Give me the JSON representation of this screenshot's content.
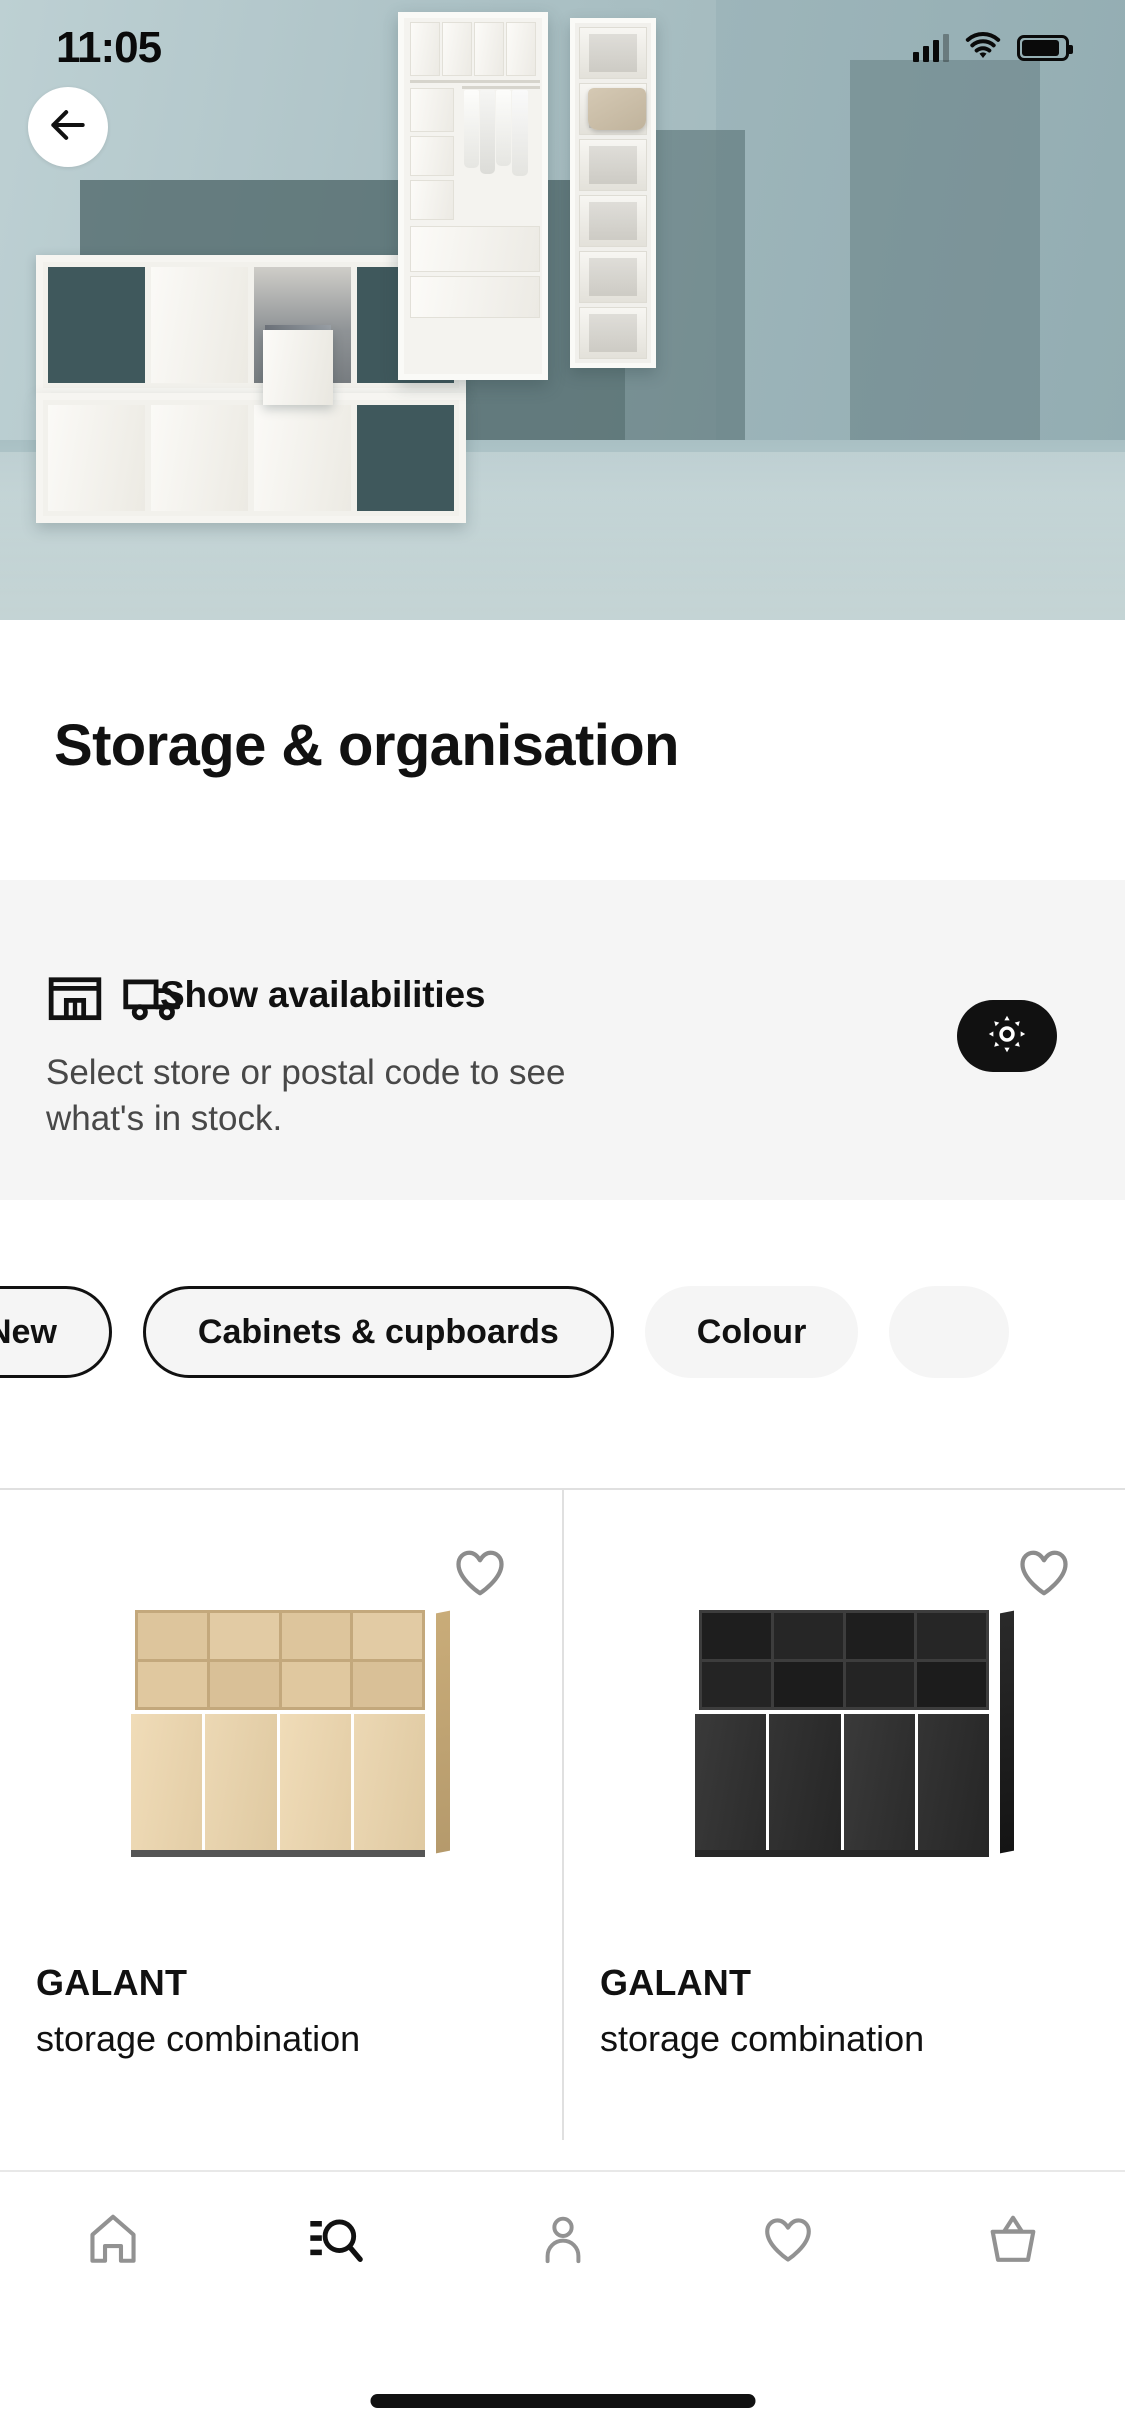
{
  "status_bar": {
    "time": "11:05",
    "signal_icon": "cellular-signal-icon",
    "wifi_icon": "wifi-icon",
    "battery_icon": "battery-icon"
  },
  "hero": {
    "back_button_icon": "arrow-left-icon",
    "alt": "White storage shelving, wardrobe and cabinets against a blue-grey wall"
  },
  "header": {
    "title": "Storage & organisation"
  },
  "availability": {
    "store_icon": "store-icon",
    "delivery_icon": "delivery-truck-icon",
    "heading": "Show availabilities",
    "subtitle": "Select store or postal code to see what's in stock.",
    "settings_button_icon": "gear-icon"
  },
  "filters": {
    "chips": [
      {
        "label": "New",
        "selected": false,
        "truncated": true
      },
      {
        "label": "Cabinets & cupboards",
        "selected": true,
        "truncated": false
      },
      {
        "label": "Colour",
        "selected": false,
        "truncated": false
      },
      {
        "label": "",
        "selected": false,
        "truncated": true
      }
    ]
  },
  "products": [
    {
      "name": "GALANT",
      "description": "storage combination",
      "favourite_icon": "heart-outline-icon",
      "image_alt": "GALANT storage combination with sliding doors, white stained oak veneer",
      "colors": {
        "body": "#e8d3ae",
        "shelf_interior": "#d9c096",
        "door": "#ecd9b7",
        "edge": "#c3a879",
        "shadow": "#2b2b2b"
      }
    },
    {
      "name": "GALANT",
      "description": "storage combination",
      "favourite_icon": "heart-outline-icon",
      "image_alt": "GALANT storage combination with sliding doors, black stained ash veneer",
      "colors": {
        "body": "#3a3a3a",
        "shelf_interior": "#232323",
        "door": "#2e2e2e",
        "edge": "#151515",
        "shadow": "#1a1a1a"
      }
    }
  ],
  "bottom_nav": {
    "items": [
      {
        "name": "home",
        "icon": "home-icon",
        "active": false
      },
      {
        "name": "browse",
        "icon": "browse-search-icon",
        "active": true
      },
      {
        "name": "profile",
        "icon": "person-icon",
        "active": false
      },
      {
        "name": "favourites",
        "icon": "heart-outline-icon",
        "active": false
      },
      {
        "name": "cart",
        "icon": "shopping-basket-icon",
        "active": false
      }
    ],
    "active_color": "#111111",
    "inactive_color": "#929292"
  },
  "system": {
    "home_indicator": "home-indicator-bar"
  },
  "theme": {
    "background": "#ffffff",
    "banner_background": "#f5f5f5",
    "chip_background": "#f5f5f5",
    "text_primary": "#111111",
    "text_secondary": "#484848",
    "divider": "#e0e0e0"
  }
}
